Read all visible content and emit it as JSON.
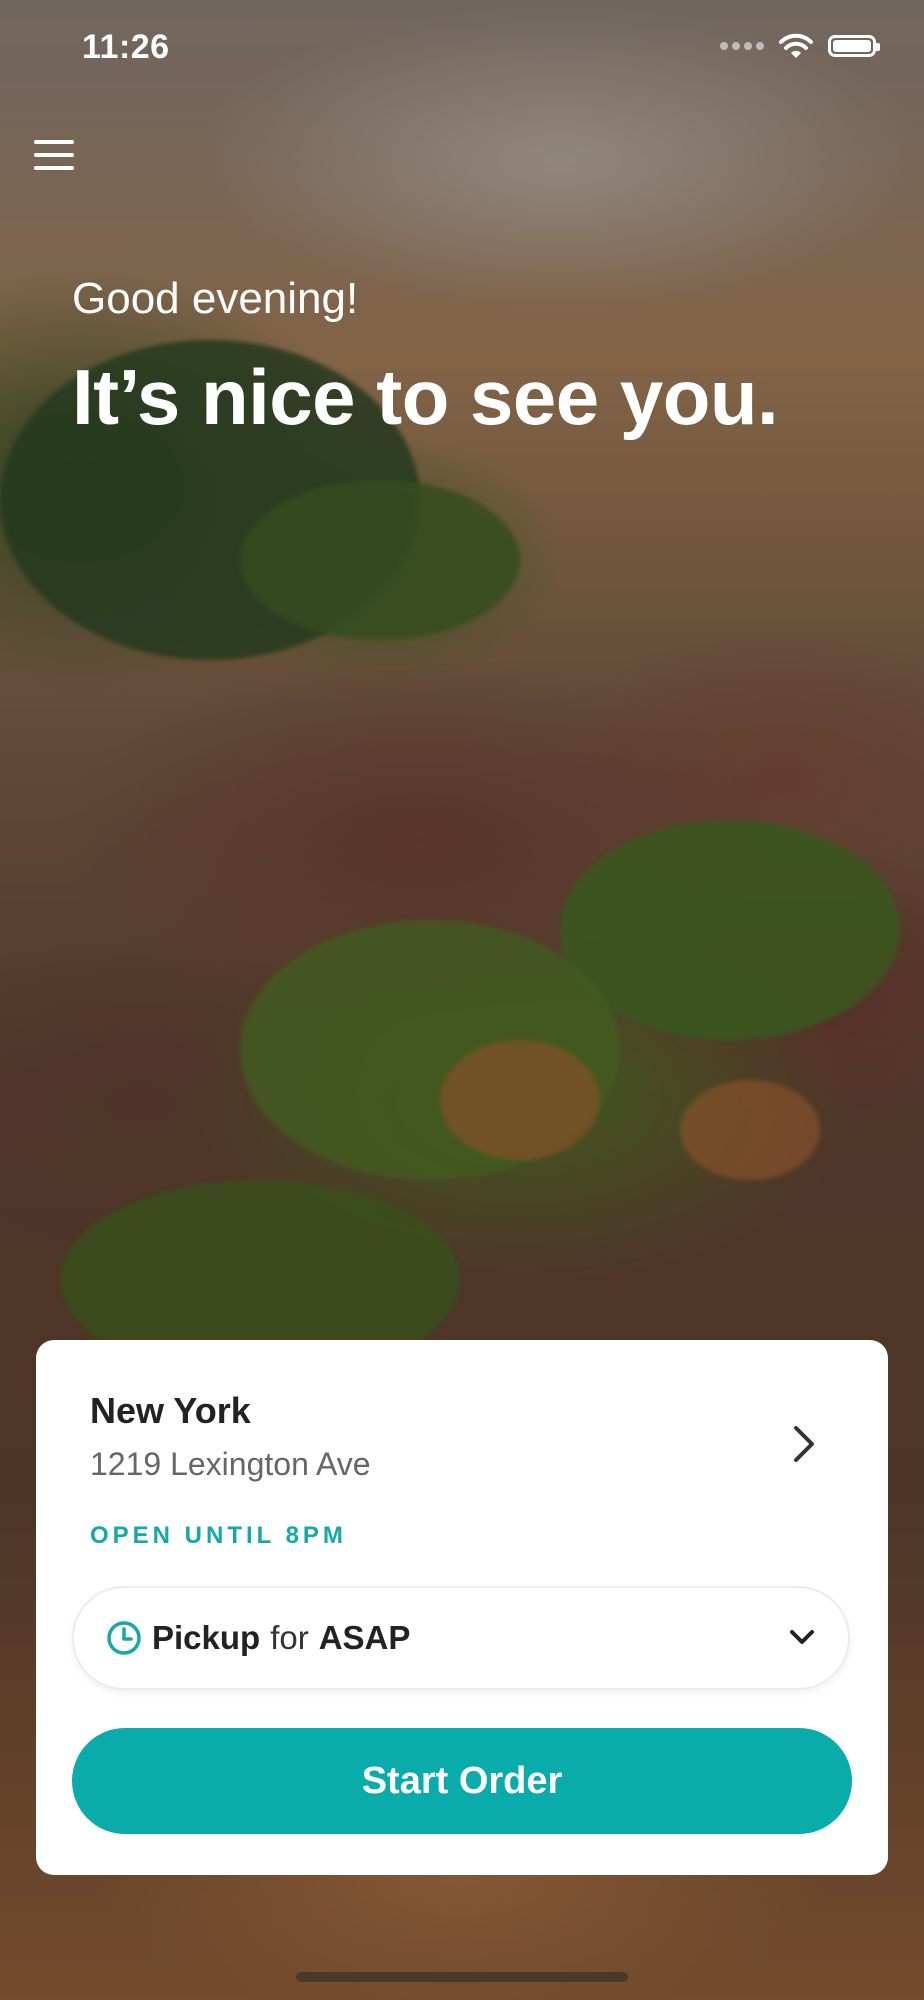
{
  "status_bar": {
    "time": "11:26",
    "icons": [
      "signal-icon",
      "wifi-icon",
      "battery-icon"
    ]
  },
  "header": {
    "menu_icon": "hamburger-menu-icon"
  },
  "hero": {
    "greeting": "Good evening!",
    "headline": "It’s nice to see you."
  },
  "location": {
    "name": "New York",
    "address": "1219 Lexington Ave",
    "status": "OPEN UNTIL 8PM",
    "icon": "chevron-right-icon"
  },
  "order_mode": {
    "mode": "Pickup",
    "connector": "for",
    "time": "ASAP",
    "icon": "clock-icon",
    "dropdown_icon": "chevron-down-icon"
  },
  "start_button": {
    "label": "Start Order"
  },
  "colors": {
    "accent": "#0aabab",
    "text_primary": "#222222",
    "text_secondary": "#666666"
  }
}
